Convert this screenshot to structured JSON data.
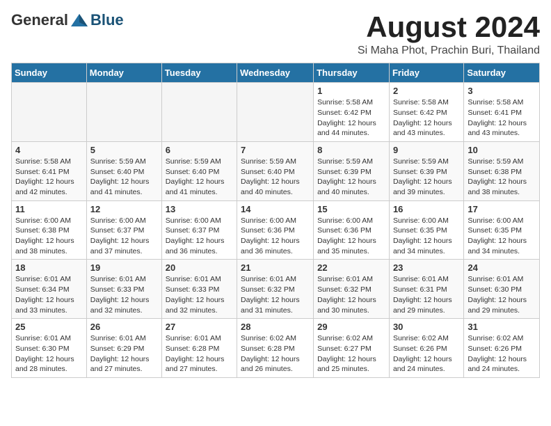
{
  "header": {
    "logo_general": "General",
    "logo_blue": "Blue",
    "month_title": "August 2024",
    "location": "Si Maha Phot, Prachin Buri, Thailand"
  },
  "weekdays": [
    "Sunday",
    "Monday",
    "Tuesday",
    "Wednesday",
    "Thursday",
    "Friday",
    "Saturday"
  ],
  "weeks": [
    [
      {
        "day": "",
        "empty": true
      },
      {
        "day": "",
        "empty": true
      },
      {
        "day": "",
        "empty": true
      },
      {
        "day": "",
        "empty": true
      },
      {
        "day": "1",
        "sunrise": "5:58 AM",
        "sunset": "6:42 PM",
        "daylight": "12 hours and 44 minutes."
      },
      {
        "day": "2",
        "sunrise": "5:58 AM",
        "sunset": "6:42 PM",
        "daylight": "12 hours and 43 minutes."
      },
      {
        "day": "3",
        "sunrise": "5:58 AM",
        "sunset": "6:41 PM",
        "daylight": "12 hours and 43 minutes."
      }
    ],
    [
      {
        "day": "4",
        "sunrise": "5:58 AM",
        "sunset": "6:41 PM",
        "daylight": "12 hours and 42 minutes."
      },
      {
        "day": "5",
        "sunrise": "5:59 AM",
        "sunset": "6:40 PM",
        "daylight": "12 hours and 41 minutes."
      },
      {
        "day": "6",
        "sunrise": "5:59 AM",
        "sunset": "6:40 PM",
        "daylight": "12 hours and 41 minutes."
      },
      {
        "day": "7",
        "sunrise": "5:59 AM",
        "sunset": "6:40 PM",
        "daylight": "12 hours and 40 minutes."
      },
      {
        "day": "8",
        "sunrise": "5:59 AM",
        "sunset": "6:39 PM",
        "daylight": "12 hours and 40 minutes."
      },
      {
        "day": "9",
        "sunrise": "5:59 AM",
        "sunset": "6:39 PM",
        "daylight": "12 hours and 39 minutes."
      },
      {
        "day": "10",
        "sunrise": "5:59 AM",
        "sunset": "6:38 PM",
        "daylight": "12 hours and 38 minutes."
      }
    ],
    [
      {
        "day": "11",
        "sunrise": "6:00 AM",
        "sunset": "6:38 PM",
        "daylight": "12 hours and 38 minutes."
      },
      {
        "day": "12",
        "sunrise": "6:00 AM",
        "sunset": "6:37 PM",
        "daylight": "12 hours and 37 minutes."
      },
      {
        "day": "13",
        "sunrise": "6:00 AM",
        "sunset": "6:37 PM",
        "daylight": "12 hours and 36 minutes."
      },
      {
        "day": "14",
        "sunrise": "6:00 AM",
        "sunset": "6:36 PM",
        "daylight": "12 hours and 36 minutes."
      },
      {
        "day": "15",
        "sunrise": "6:00 AM",
        "sunset": "6:36 PM",
        "daylight": "12 hours and 35 minutes."
      },
      {
        "day": "16",
        "sunrise": "6:00 AM",
        "sunset": "6:35 PM",
        "daylight": "12 hours and 34 minutes."
      },
      {
        "day": "17",
        "sunrise": "6:00 AM",
        "sunset": "6:35 PM",
        "daylight": "12 hours and 34 minutes."
      }
    ],
    [
      {
        "day": "18",
        "sunrise": "6:01 AM",
        "sunset": "6:34 PM",
        "daylight": "12 hours and 33 minutes."
      },
      {
        "day": "19",
        "sunrise": "6:01 AM",
        "sunset": "6:33 PM",
        "daylight": "12 hours and 32 minutes."
      },
      {
        "day": "20",
        "sunrise": "6:01 AM",
        "sunset": "6:33 PM",
        "daylight": "12 hours and 32 minutes."
      },
      {
        "day": "21",
        "sunrise": "6:01 AM",
        "sunset": "6:32 PM",
        "daylight": "12 hours and 31 minutes."
      },
      {
        "day": "22",
        "sunrise": "6:01 AM",
        "sunset": "6:32 PM",
        "daylight": "12 hours and 30 minutes."
      },
      {
        "day": "23",
        "sunrise": "6:01 AM",
        "sunset": "6:31 PM",
        "daylight": "12 hours and 29 minutes."
      },
      {
        "day": "24",
        "sunrise": "6:01 AM",
        "sunset": "6:30 PM",
        "daylight": "12 hours and 29 minutes."
      }
    ],
    [
      {
        "day": "25",
        "sunrise": "6:01 AM",
        "sunset": "6:30 PM",
        "daylight": "12 hours and 28 minutes."
      },
      {
        "day": "26",
        "sunrise": "6:01 AM",
        "sunset": "6:29 PM",
        "daylight": "12 hours and 27 minutes."
      },
      {
        "day": "27",
        "sunrise": "6:01 AM",
        "sunset": "6:28 PM",
        "daylight": "12 hours and 27 minutes."
      },
      {
        "day": "28",
        "sunrise": "6:02 AM",
        "sunset": "6:28 PM",
        "daylight": "12 hours and 26 minutes."
      },
      {
        "day": "29",
        "sunrise": "6:02 AM",
        "sunset": "6:27 PM",
        "daylight": "12 hours and 25 minutes."
      },
      {
        "day": "30",
        "sunrise": "6:02 AM",
        "sunset": "6:26 PM",
        "daylight": "12 hours and 24 minutes."
      },
      {
        "day": "31",
        "sunrise": "6:02 AM",
        "sunset": "6:26 PM",
        "daylight": "12 hours and 24 minutes."
      }
    ]
  ],
  "labels": {
    "sunrise": "Sunrise:",
    "sunset": "Sunset:",
    "daylight": "Daylight: 12 hours"
  }
}
